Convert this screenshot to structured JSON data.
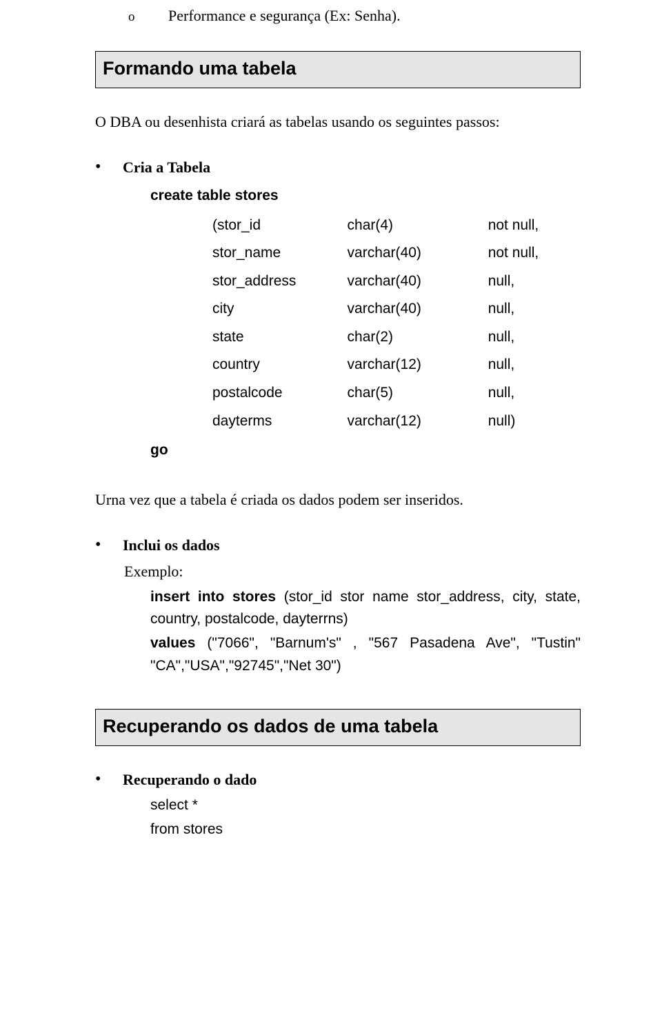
{
  "top_bullet": {
    "marker": "o",
    "text": "Performance e segurança (Ex: Senha)."
  },
  "heading1": "Formando uma tabela",
  "intro": "O DBA ou desenhista criará as tabelas usando os seguintes passos:",
  "create_bullet": "Cria a Tabela",
  "create_line": "create table stores",
  "columns": [
    {
      "name": "(stor_id",
      "type": "char(4)",
      "null": "not null,"
    },
    {
      "name": "stor_name",
      "type": "varchar(40)",
      "null": "not null,"
    },
    {
      "name": "stor_address",
      "type": "varchar(40)",
      "null": "null,"
    },
    {
      "name": "city",
      "type": "varchar(40)",
      "null": "null,"
    },
    {
      "name": "state",
      "type": "char(2)",
      "null": "null,"
    },
    {
      "name": "country",
      "type": "varchar(12)",
      "null": "null,"
    },
    {
      "name": "postalcode",
      "type": "char(5)",
      "null": "null,"
    },
    {
      "name": "dayterms",
      "type": "varchar(12)",
      "null": "null)"
    }
  ],
  "go": "go",
  "urna": "Urna vez que a tabela é criada os dados podem ser inseridos.",
  "inclui": {
    "title": "Inclui os dados",
    "exemplo": "Exemplo:",
    "line1a": "insert into stores ",
    "line1b": "(stor_id stor name stor_address, city, state, country, postalcode, dayterrns)",
    "line2a": "values ",
    "line2b": "(\"7066\", \"Barnum's\" , \"567 Pasadena Ave\", \"Tustin\" \"CA\",\"USA\",\"92745\",\"Net 30\")"
  },
  "heading2": "Recuperando os dados de uma tabela",
  "recup": {
    "title": "Recuperando o dado",
    "l1": "select *",
    "l2": "from stores"
  }
}
